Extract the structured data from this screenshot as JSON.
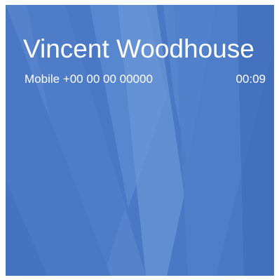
{
  "call": {
    "caller_name": "Vincent Woodhouse",
    "number_label": "Mobile +00 00 00 00000",
    "timer": "00:09"
  },
  "background": {
    "logo_icon": "w-logo-watermark-icon",
    "base_color": "#4a78c4",
    "light_color": "#6a95d6",
    "dark_color": "#3f6bb8"
  }
}
